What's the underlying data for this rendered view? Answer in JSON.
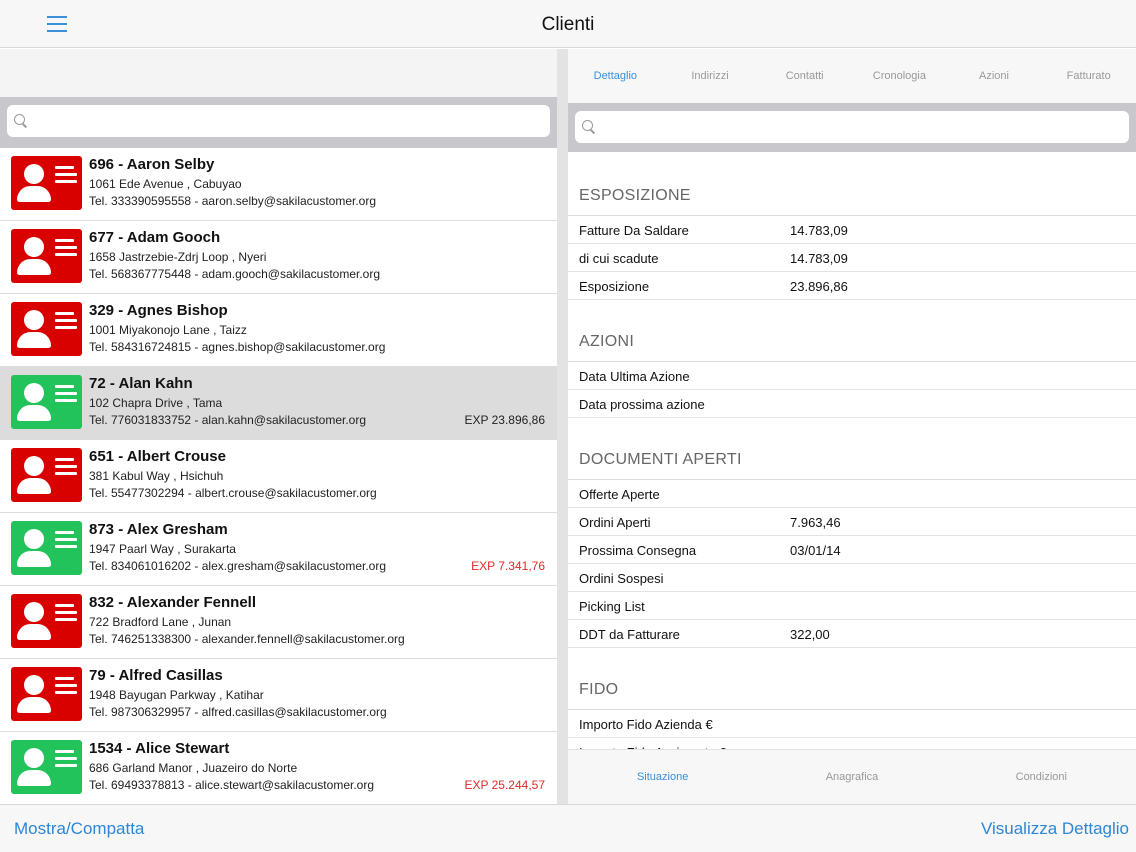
{
  "header": {
    "title": "Clienti",
    "menu_icon": "hamburger-menu-icon"
  },
  "left_search": {
    "placeholder": ""
  },
  "clients": [
    {
      "name": "696 - Aaron Selby",
      "address": "1061 Ede Avenue , Cabuyao",
      "contact": "Tel. 333390595558 - aaron.selby@sakilacustomer.org",
      "exp": "",
      "status": "red"
    },
    {
      "name": "677 - Adam Gooch",
      "address": "1658 Jastrzebie-Zdrj Loop , Nyeri",
      "contact": "Tel. 568367775448 - adam.gooch@sakilacustomer.org",
      "exp": "",
      "status": "red"
    },
    {
      "name": "329 - Agnes Bishop",
      "address": "1001 Miyakonojo Lane , Taizz",
      "contact": "Tel. 584316724815 - agnes.bishop@sakilacustomer.org",
      "exp": "",
      "status": "red"
    },
    {
      "name": "72 - Alan Kahn",
      "address": "102 Chapra Drive , Tama",
      "contact": "Tel. 776031833752 - alan.kahn@sakilacustomer.org",
      "exp": "EXP 23.896,86",
      "status": "green"
    },
    {
      "name": "651 - Albert Crouse",
      "address": "381 Kabul Way , Hsichuh",
      "contact": "Tel. 55477302294 - albert.crouse@sakilacustomer.org",
      "exp": "",
      "status": "red"
    },
    {
      "name": "873 - Alex Gresham",
      "address": "1947 Paarl Way , Surakarta",
      "contact": "Tel. 834061016202 - alex.gresham@sakilacustomer.org",
      "exp": "EXP 7.341,76",
      "status": "green"
    },
    {
      "name": "832 - Alexander Fennell",
      "address": "722 Bradford Lane , Junan",
      "contact": "Tel. 746251338300 - alexander.fennell@sakilacustomer.org",
      "exp": "",
      "status": "red"
    },
    {
      "name": "79 - Alfred Casillas",
      "address": "1948 Bayugan Parkway , Katihar",
      "contact": "Tel. 987306329957 - alfred.casillas@sakilacustomer.org",
      "exp": "",
      "status": "red"
    },
    {
      "name": "1534 - Alice Stewart",
      "address": "686 Garland Manor , Juazeiro do Norte",
      "contact": "Tel. 69493378813 - alice.stewart@sakilacustomer.org",
      "exp": "EXP 25.244,57",
      "status": "green"
    }
  ],
  "detail_tabs": [
    "Dettaglio",
    "Indirizzi",
    "Contatti",
    "Cronologia",
    "Azioni",
    "Fatturato"
  ],
  "right_search": {
    "placeholder": ""
  },
  "sections": [
    {
      "title": "ESPOSIZIONE",
      "rows": [
        {
          "key": "Fatture Da Saldare",
          "value": "14.783,09"
        },
        {
          "key": "di cui scadute",
          "value": "14.783,09"
        },
        {
          "key": "Esposizione",
          "value": "23.896,86"
        }
      ]
    },
    {
      "title": "AZIONI",
      "rows": [
        {
          "key": "Data Ultima Azione",
          "value": ""
        },
        {
          "key": "Data prossima azione",
          "value": ""
        }
      ]
    },
    {
      "title": "DOCUMENTI APERTI",
      "rows": [
        {
          "key": "Offerte Aperte",
          "value": ""
        },
        {
          "key": "Ordini Aperti",
          "value": "7.963,46"
        },
        {
          "key": "Prossima Consegna",
          "value": "03/01/14"
        },
        {
          "key": "Ordini Sospesi",
          "value": ""
        },
        {
          "key": "Picking List",
          "value": ""
        },
        {
          "key": "DDT da Fatturare",
          "value": "322,00"
        }
      ]
    },
    {
      "title": "FIDO",
      "rows": [
        {
          "key": "Importo Fido Azienda €",
          "value": ""
        },
        {
          "key": "Importo Fido Assicurato €",
          "value": ""
        }
      ]
    }
  ],
  "right_bottom_tabs": [
    "Situazione",
    "Anagrafica",
    "Condizioni"
  ],
  "bottom": {
    "left_label": "Mostra/Compatta",
    "right_label": "Visualizza Dettaglio"
  },
  "colors": {
    "accent": "#2d86d6",
    "red_status": "#d90000",
    "green_status": "#22c35a",
    "exp_red": "#e12a2a"
  }
}
